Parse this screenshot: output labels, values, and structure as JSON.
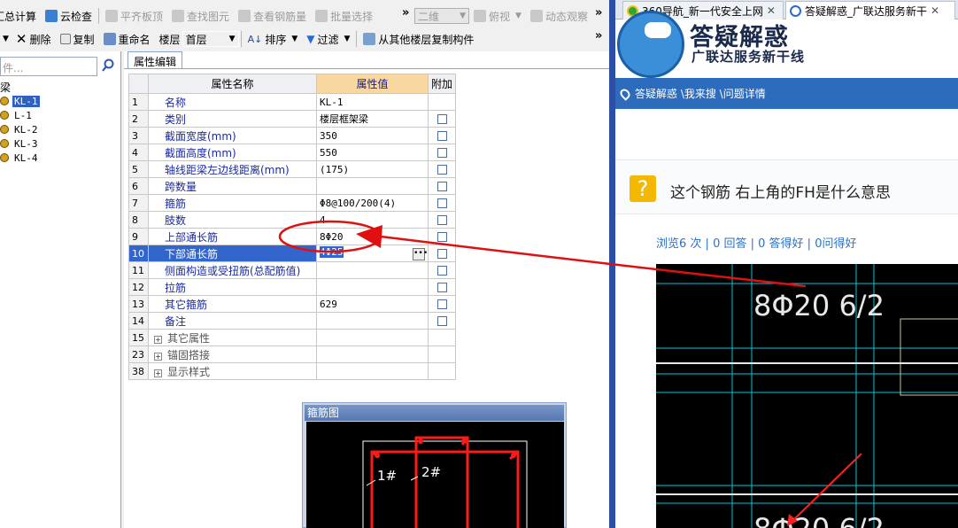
{
  "toolbar_row1": {
    "summary_calc": "汇总计算",
    "cloud_check": "云检查",
    "level_slab_top": "平齐板顶",
    "find_element": "查找图元",
    "view_rebar": "查看钢筋量",
    "batch_select": "批量选择",
    "view_mode": "二维",
    "view_angle": "俯视",
    "dynamic_view": "动态观察"
  },
  "toolbar_row2": {
    "delete": "删除",
    "copy": "复制",
    "rename": "重命名",
    "floor_label": "楼层",
    "floor_value": "首层",
    "sort": "排序",
    "filter": "过滤",
    "copy_from_floor": "从其他楼层复制构件"
  },
  "left_panel": {
    "search_placeholder": "件...",
    "root_label": "梁",
    "items": [
      "KL-1",
      "L-1",
      "KL-2",
      "KL-3",
      "KL-4"
    ]
  },
  "property_editor": {
    "tab_label": "属性编辑",
    "headers": {
      "name": "属性名称",
      "value": "属性值",
      "extra": "附加"
    },
    "rows": [
      {
        "num": "1",
        "name": "名称",
        "value": "KL-1"
      },
      {
        "num": "2",
        "name": "类别",
        "value": "楼层框架梁"
      },
      {
        "num": "3",
        "name": "截面宽度(mm)",
        "value": "350"
      },
      {
        "num": "4",
        "name": "截面高度(mm)",
        "value": "550"
      },
      {
        "num": "5",
        "name": "轴线距梁左边线距离(mm)",
        "value": "(175)"
      },
      {
        "num": "6",
        "name": "跨数量",
        "value": ""
      },
      {
        "num": "7",
        "name": "箍筋",
        "value": "Φ8@100/200(4)"
      },
      {
        "num": "8",
        "name": "肢数",
        "value": "4"
      },
      {
        "num": "9",
        "name": "上部通长筋",
        "value": "8Φ20"
      },
      {
        "num": "10",
        "name": "下部通长筋",
        "value": "4Φ25"
      },
      {
        "num": "11",
        "name": "侧面构造或受扭筋(总配筋值)",
        "value": ""
      },
      {
        "num": "12",
        "name": "拉筋",
        "value": ""
      },
      {
        "num": "13",
        "name": "其它箍筋",
        "value": "629"
      },
      {
        "num": "14",
        "name": "备注",
        "value": ""
      },
      {
        "num": "15",
        "name": "其它属性",
        "value": ""
      },
      {
        "num": "23",
        "name": "锚固搭接",
        "value": ""
      },
      {
        "num": "38",
        "name": "显示样式",
        "value": ""
      }
    ]
  },
  "stirrup_window": {
    "title": "箍筋图",
    "label1": "1#",
    "label2": "2#"
  },
  "browser": {
    "tabs": [
      {
        "title": "360导航_新一代安全上网"
      },
      {
        "title": "答疑解惑_广联达服务新干"
      }
    ],
    "site_title": "答疑解惑",
    "site_subtitle": "广联达服务新干线",
    "breadcrumb": "答疑解惑 \\我来搜 \\问题详情",
    "question_title": "这个钢筋 右上角的FH是什么意思",
    "stats": {
      "views": "浏览6 次",
      "answers": "0 回答",
      "good_answers": "0 答得好",
      "helpful": "0问得好"
    },
    "image_text_top": "8Φ20 6/2",
    "image_text_bottom": "8Φ20 6/2"
  },
  "colors": {
    "accent_blue": "#2d6bbd",
    "selection": "#3266cc",
    "annotation_red": "#e01010",
    "cad_cyan": "#00c8d8"
  }
}
